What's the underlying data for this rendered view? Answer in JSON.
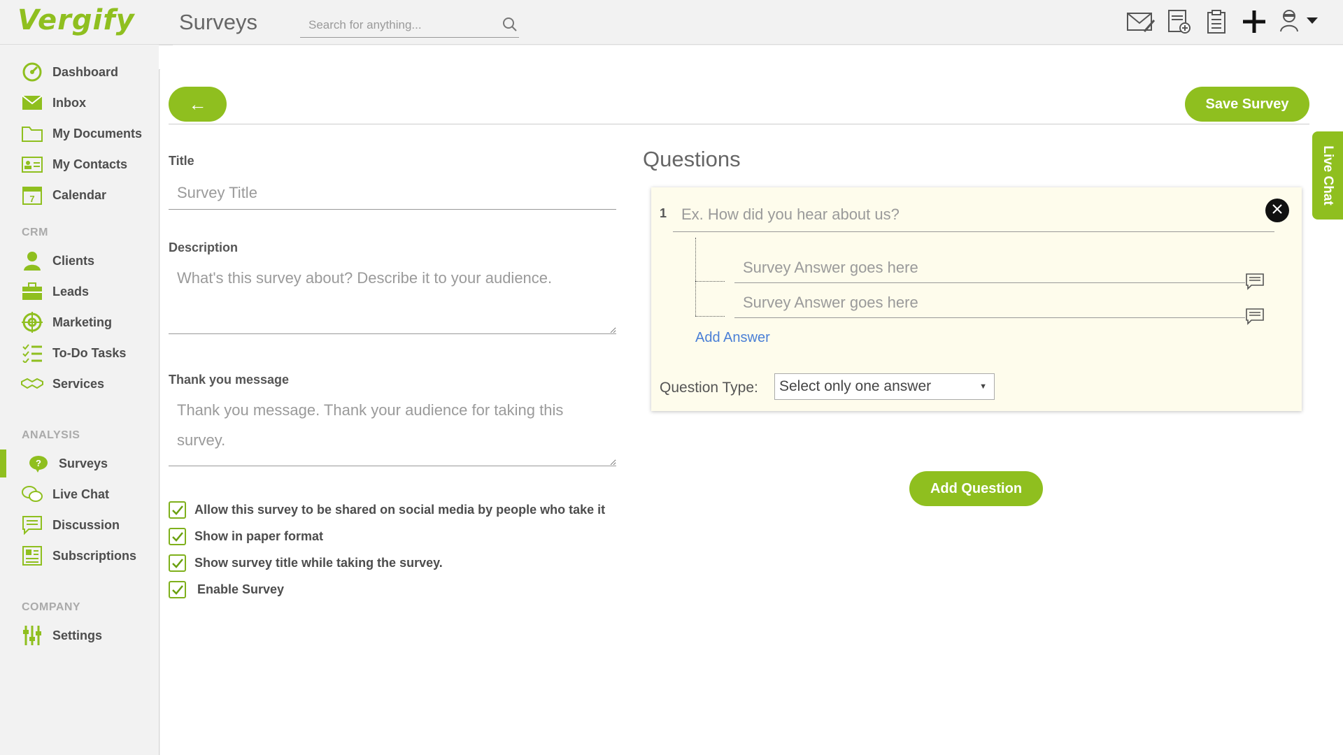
{
  "app": {
    "logo": "Vergify",
    "page_title": "Surveys"
  },
  "search": {
    "placeholder": "Search for anything..."
  },
  "top_icons": [
    "compose-mail-icon",
    "new-document-icon",
    "clipboard-icon",
    "plus-icon",
    "user-avatar-icon"
  ],
  "sidebar": {
    "items": [
      {
        "label": "Dashboard",
        "icon": "dashboard-icon"
      },
      {
        "label": "Inbox",
        "icon": "inbox-icon"
      },
      {
        "label": "My Documents",
        "icon": "folder-icon"
      },
      {
        "label": "My Contacts",
        "icon": "contacts-icon"
      },
      {
        "label": "Calendar",
        "icon": "calendar-icon"
      }
    ],
    "crm_label": "CRM",
    "crm_items": [
      {
        "label": "Clients",
        "icon": "client-icon"
      },
      {
        "label": "Leads",
        "icon": "briefcase-icon"
      },
      {
        "label": "Marketing",
        "icon": "target-icon"
      },
      {
        "label": "To-Do Tasks",
        "icon": "checklist-icon"
      },
      {
        "label": "Services",
        "icon": "handshake-icon"
      }
    ],
    "analysis_label": "ANALYSIS",
    "analysis_items": [
      {
        "label": "Surveys",
        "icon": "survey-icon",
        "active": true
      },
      {
        "label": "Live Chat",
        "icon": "chat-bubbles-icon"
      },
      {
        "label": "Discussion",
        "icon": "discussion-icon"
      },
      {
        "label": "Subscriptions",
        "icon": "newspaper-icon"
      }
    ],
    "company_label": "COMPANY",
    "company_items": [
      {
        "label": "Settings",
        "icon": "sliders-icon"
      }
    ]
  },
  "toolbar": {
    "back_label": "←",
    "save_label": "Save Survey"
  },
  "form": {
    "title_label": "Title",
    "title_placeholder": "Survey Title",
    "description_label": "Description",
    "description_placeholder": "What's this survey about? Describe it to your audience.",
    "thanks_label": "Thank you message",
    "thanks_placeholder": "Thank you message. Thank your audience for taking this survey.",
    "options": [
      {
        "label": "Allow this survey to be shared on social media by people who take it",
        "checked": true
      },
      {
        "label": "Show in paper format",
        "checked": true
      },
      {
        "label": "Show survey title while taking the survey.",
        "checked": true
      },
      {
        "label": "Enable Survey",
        "checked": true
      }
    ]
  },
  "questions": {
    "heading": "Questions",
    "items": [
      {
        "number": "1",
        "placeholder": "Ex. How did you hear about us?",
        "answers": [
          {
            "placeholder": "Survey Answer goes here"
          },
          {
            "placeholder": "Survey Answer goes here"
          }
        ],
        "add_answer_label": "Add Answer",
        "type_label": "Question Type:",
        "type_value": "Select only one answer"
      }
    ],
    "add_question_label": "Add Question"
  },
  "live_chat": {
    "label": "Live Chat"
  },
  "colors": {
    "accent": "#8fbf1f",
    "link": "#4a7fd6",
    "card": "#fefcec"
  }
}
